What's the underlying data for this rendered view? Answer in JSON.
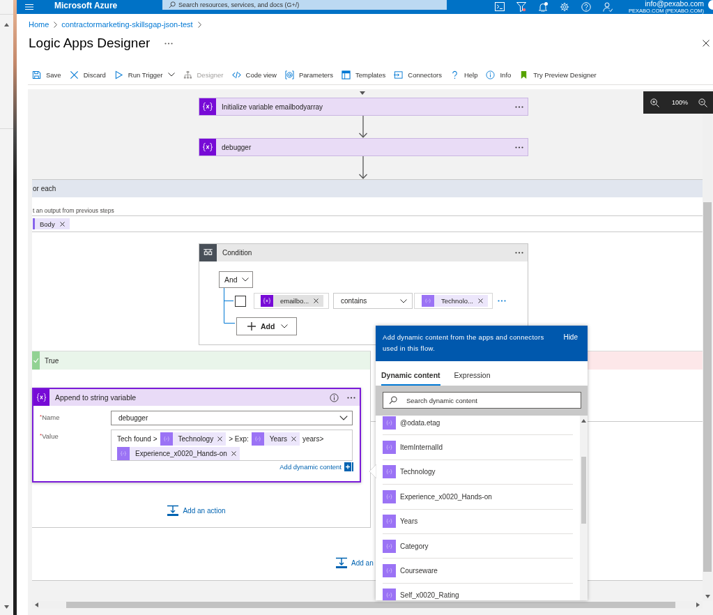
{
  "portal": {
    "brand": "Microsoft Azure",
    "search": {
      "placeholder": "Search resources, services, and docs (G+/)"
    },
    "account": {
      "email": "info@pexabo.com",
      "directory": "PEXABO.COM (PEXABO.COM)"
    }
  },
  "breadcrumb": [
    {
      "label": "Home"
    },
    {
      "label": "contractormarketing-skillsgap-json-test"
    }
  ],
  "title": "Logic Apps Designer",
  "toolbar": [
    {
      "kind": "save",
      "label": "Save",
      "disabled": false,
      "menu": false
    },
    {
      "kind": "discard",
      "label": "Discard",
      "disabled": false,
      "menu": false
    },
    {
      "kind": "run",
      "label": "Run Trigger",
      "disabled": false,
      "menu": true
    },
    {
      "kind": "designer",
      "label": "Designer",
      "disabled": true,
      "menu": false
    },
    {
      "kind": "code",
      "label": "Code view",
      "disabled": false,
      "menu": false
    },
    {
      "kind": "parameters",
      "label": "Parameters",
      "disabled": false,
      "menu": false
    },
    {
      "kind": "templates",
      "label": "Templates",
      "disabled": false,
      "menu": false
    },
    {
      "kind": "connectors",
      "label": "Connectors",
      "disabled": false,
      "menu": false
    },
    {
      "kind": "help",
      "label": "Help",
      "disabled": false,
      "menu": false
    },
    {
      "kind": "info",
      "label": "Info",
      "disabled": false,
      "menu": false
    },
    {
      "kind": "preview",
      "label": "Try Preview Designer",
      "disabled": false,
      "menu": false
    }
  ],
  "zoom": {
    "reading": "100%"
  },
  "steps": [
    {
      "kind": "variable",
      "title": "Initialize variable emailbodyarray"
    },
    {
      "kind": "variable",
      "title": "debugger"
    }
  ],
  "for_each": {
    "title": "or each",
    "input_label": "t an output from previous steps",
    "inputs": [
      {
        "kind": "output",
        "label": "Body"
      }
    ],
    "condition": {
      "kind": "condition",
      "title": "Condition",
      "group": "And",
      "rows": [
        {
          "checked": false,
          "left": {
            "kind": "variable",
            "label": "emailbo..."
          },
          "operator": "contains",
          "right": {
            "kind": "dynamic",
            "label": "Technolo..."
          }
        }
      ],
      "add": "Add"
    },
    "branches": [
      {
        "kind": "true",
        "label": "True",
        "actions": [
          {
            "kind": "variable",
            "title": "Append to string variable",
            "selected": true,
            "fields": [
              {
                "kind": "dropdown",
                "required_mark": "*",
                "label": "Name",
                "value": "debugger"
              },
              {
                "kind": "tokens",
                "required_mark": "*",
                "label": "Value",
                "parts": [
                  {
                    "kind": "text",
                    "text": "Tech found >"
                  },
                  {
                    "kind": "dynamic",
                    "label": "Technology"
                  },
                  {
                    "kind": "text",
                    "text": "> Exp:"
                  },
                  {
                    "kind": "dynamic",
                    "label": "Years"
                  },
                  {
                    "kind": "text",
                    "text": "years>"
                  },
                  {
                    "kind": "dynamic",
                    "label": "Experience_x0020_Hands-on"
                  }
                ]
              }
            ],
            "link": "Add dynamic content"
          }
        ],
        "add_action": "Add an action"
      },
      {
        "kind": "false"
      }
    ],
    "add_action": "Add an"
  },
  "dynamic_panel": {
    "intro": "Add dynamic content from the apps and connectors used in this flow.",
    "hide": "Hide",
    "tabs": [
      {
        "label": "Dynamic content",
        "selected": true
      },
      {
        "label": "Expression",
        "selected": false
      }
    ],
    "search": {
      "placeholder": "Search dynamic content"
    },
    "items": [
      {
        "label": "@odata.etag"
      },
      {
        "label": "ItemInternalId"
      },
      {
        "label": "Technology"
      },
      {
        "label": "Experience_x0020_Hands-on"
      },
      {
        "label": "Years"
      },
      {
        "label": "Category"
      },
      {
        "label": "Courseware"
      },
      {
        "label": "Self_x0020_Rating"
      }
    ]
  }
}
